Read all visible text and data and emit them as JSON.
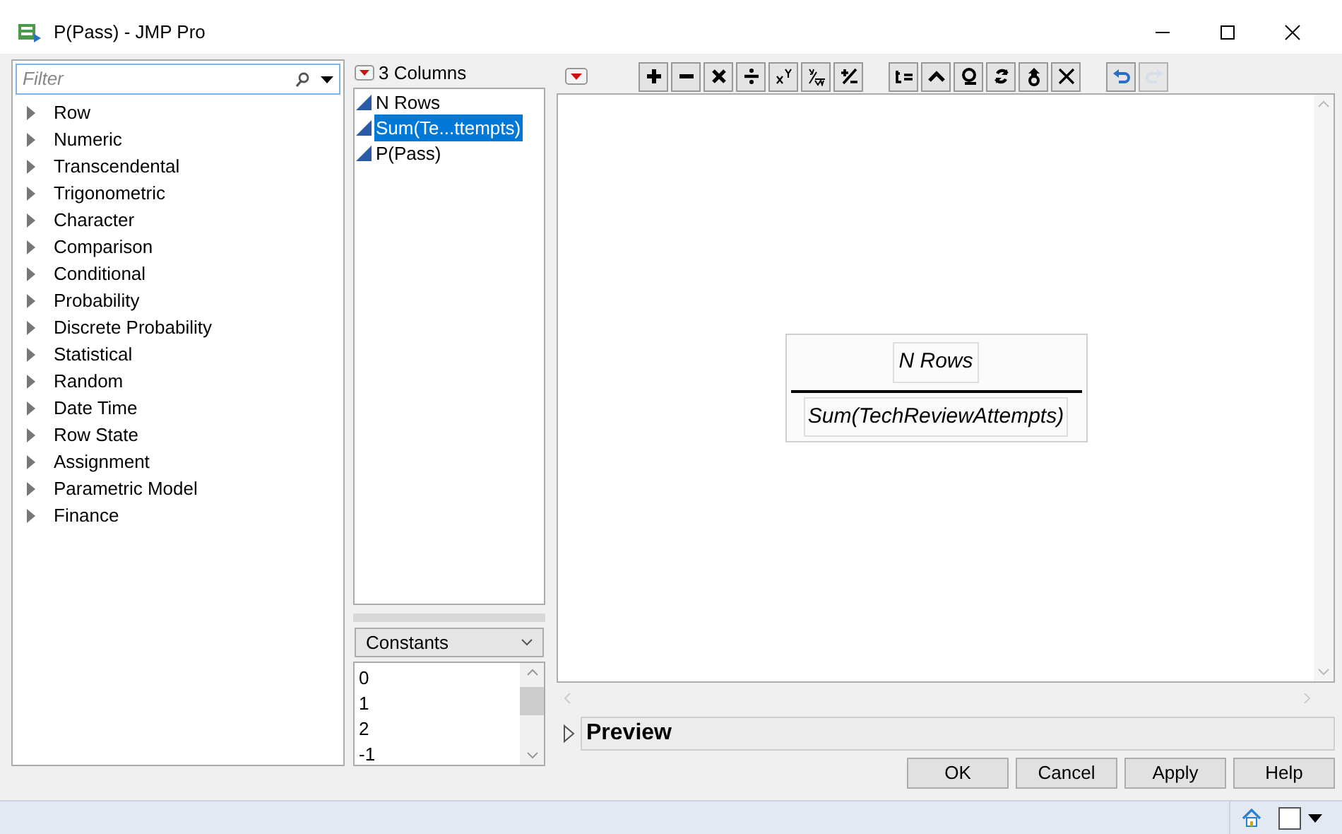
{
  "window": {
    "title": "P(Pass) - JMP Pro"
  },
  "filter": {
    "placeholder": "Filter"
  },
  "function_groups": [
    "Row",
    "Numeric",
    "Transcendental",
    "Trigonometric",
    "Character",
    "Comparison",
    "Conditional",
    "Probability",
    "Discrete Probability",
    "Statistical",
    "Random",
    "Date Time",
    "Row State",
    "Assignment",
    "Parametric Model",
    "Finance"
  ],
  "columns": {
    "title": "3 Columns",
    "items": [
      {
        "name": "N Rows",
        "selected": false
      },
      {
        "name": "Sum(Te...ttempts)",
        "selected": true
      },
      {
        "name": "P(Pass)",
        "selected": false
      }
    ]
  },
  "constants": {
    "dropdown": "Constants",
    "items": [
      "0",
      "1",
      "2",
      "-1"
    ]
  },
  "toolbar": [
    {
      "kind": "plus"
    },
    {
      "kind": "minus"
    },
    {
      "kind": "times"
    },
    {
      "kind": "divide"
    },
    {
      "kind": "power"
    },
    {
      "kind": "root"
    },
    {
      "kind": "sign"
    },
    {
      "kind": "gap"
    },
    {
      "kind": "assign"
    },
    {
      "kind": "caret"
    },
    {
      "kind": "loop"
    },
    {
      "kind": "swap"
    },
    {
      "kind": "unwrap"
    },
    {
      "kind": "delete"
    },
    {
      "kind": "gap"
    },
    {
      "kind": "undo",
      "disabled": false
    },
    {
      "kind": "redo",
      "disabled": true
    }
  ],
  "formula": {
    "numerator": "N Rows",
    "denominator": "Sum(TechReviewAttempts)"
  },
  "preview": {
    "label": "Preview",
    "expanded": false
  },
  "buttons": [
    "OK",
    "Cancel",
    "Apply",
    "Help"
  ]
}
